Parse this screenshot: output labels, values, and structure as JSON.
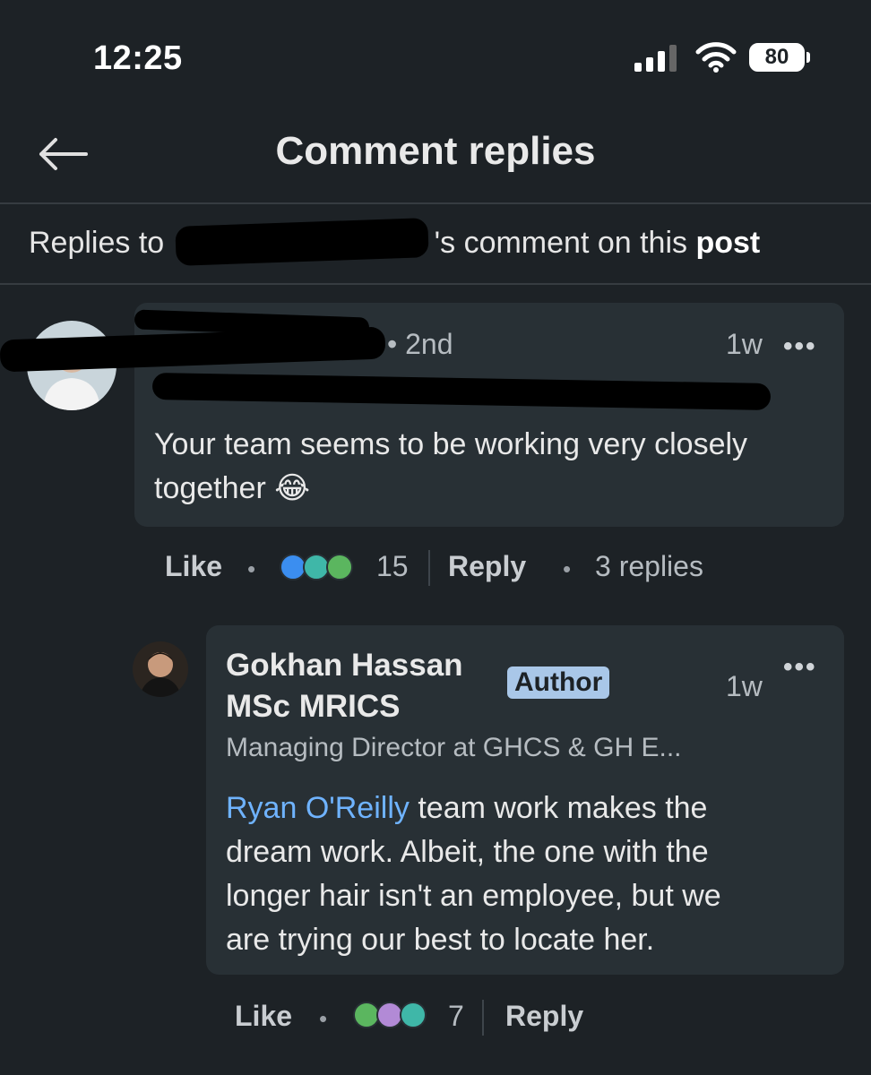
{
  "status_bar": {
    "time": "12:25",
    "battery": "80"
  },
  "header": {
    "title": "Comment replies"
  },
  "context": {
    "prefix": "Replies to ",
    "middle": "'s comment on this post",
    "post_link": "post"
  },
  "parent_comment": {
    "degree": "• 2nd",
    "time": "1w",
    "more": "•••",
    "text": "Your team seems to be working very closely together 😂",
    "actions": {
      "like": "Like",
      "reaction_count": "15",
      "reply": "Reply",
      "replies": "3 replies"
    }
  },
  "reply": {
    "name_line1": "Gokhan Hassan",
    "name_line2": "MSc MRICS",
    "badge": "Author",
    "time": "1w",
    "more": "•••",
    "headline": "Managing Director at GHCS & GH E...",
    "mention": "Ryan O'Reilly",
    "text_line1": " team work makes the",
    "text_line2": "dream work. Albeit, the one with the",
    "text_line3": "longer hair isn't an employee, but we",
    "text_line4": "are trying our best to locate her.",
    "actions": {
      "like": "Like",
      "reaction_count": "7",
      "reply": "Reply"
    }
  },
  "colors": {
    "background": "#1d2226",
    "bubble": "#283035",
    "mention": "#6fb3ff",
    "badge": "#a9c7e8"
  }
}
